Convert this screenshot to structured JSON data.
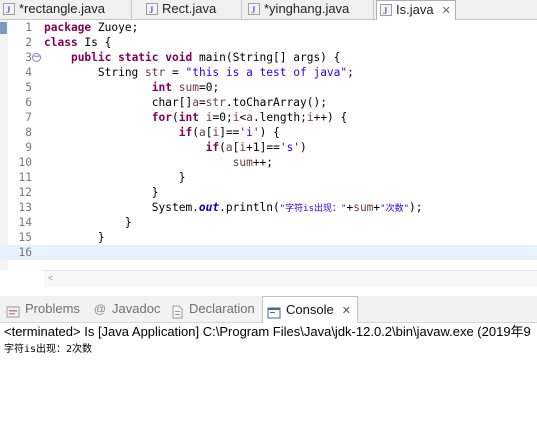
{
  "editor_tabs": [
    {
      "label": "*rectangle.java",
      "active": false
    },
    {
      "label": "Rect.java",
      "active": false
    },
    {
      "label": "*yinghang.java",
      "active": false
    },
    {
      "label": "Is.java",
      "active": true
    }
  ],
  "editor": {
    "line_numbers": [
      "1",
      "2",
      "3",
      "4",
      "5",
      "6",
      "7",
      "8",
      "9",
      "10",
      "11",
      "12",
      "13",
      "14",
      "15",
      "16"
    ],
    "lines": {
      "l1_kw": "package",
      "l1_rest": " Zuoye;",
      "l2_kw": "class",
      "l2_rest": " Is {",
      "l3_indent": "    ",
      "l3_kw": "public static void",
      "l3_rest": " main(String[] args) {",
      "l4_pre": "        String ",
      "l4_var": "str",
      "l4_eq": " = ",
      "l4_str": "\"this is a test of java\"",
      "l4_end": ";",
      "l5_pre": "                ",
      "l5_kw": "int",
      "l5_sp": " ",
      "l5_var": "sum",
      "l5_end": "=0;",
      "l6_pre": "                char[]",
      "l6_var": "a",
      "l6_eq": "=",
      "l6_var2": "str",
      "l6_end": ".toCharArray();",
      "l7_pre": "                ",
      "l7_kw": "for",
      "l7_a": "(",
      "l7_kw2": "int",
      "l7_sp": " ",
      "l7_v1": "i",
      "l7_b": "=0;",
      "l7_v2": "i",
      "l7_c": "<",
      "l7_v3": "a",
      "l7_d": ".length;",
      "l7_v4": "i",
      "l7_e": "++) {",
      "l8_pre": "                    ",
      "l8_kw": "if",
      "l8_a": "(",
      "l8_v1": "a",
      "l8_b": "[",
      "l8_v2": "i",
      "l8_c": "]==",
      "l8_str": "'i'",
      "l8_end": ") {",
      "l9_pre": "                        ",
      "l9_kw": "if",
      "l9_a": "(",
      "l9_v1": "a",
      "l9_b": "[",
      "l9_v2": "i",
      "l9_c": "+1]==",
      "l9_str": "'s'",
      "l9_end": ")",
      "l10_pre": "                            ",
      "l10_var": "sum",
      "l10_end": "++;",
      "l11": "                    }",
      "l12": "                }",
      "l13_pre": "                System.",
      "l13_fld": "out",
      "l13_a": ".println(",
      "l13_s1": "\"字符is出现：\"",
      "l13_b": "+",
      "l13_var": "sum",
      "l13_c": "+",
      "l13_s2": "\"次数\"",
      "l13_end": ");",
      "l14": "            }",
      "l15": "        }",
      "l16": ""
    }
  },
  "views": {
    "tabs": [
      {
        "label": "Problems",
        "icon": "problems-icon",
        "active": false
      },
      {
        "label": "Javadoc",
        "icon": "javadoc-at-icon",
        "active": false
      },
      {
        "label": "Declaration",
        "icon": "declaration-icon",
        "active": false
      },
      {
        "label": "Console",
        "icon": "console-icon",
        "active": true
      }
    ],
    "close_glyph": "✕"
  },
  "console": {
    "header": "<terminated> Is [Java Application] C:\\Program Files\\Java\\jdk-12.0.2\\bin\\javaw.exe (2019年9",
    "output": "字符is出现：2次数"
  },
  "colors": {
    "keyword": "#7f0055",
    "string": "#2a00ff",
    "field": "#0000c0",
    "local_var": "#6a3e3e",
    "current_line": "#e8f2fe"
  }
}
